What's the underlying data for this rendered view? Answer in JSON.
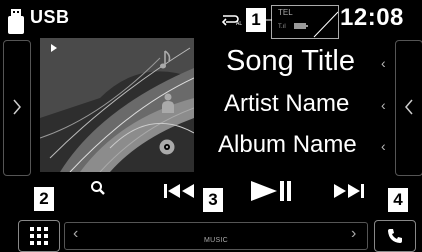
{
  "status_bar": {
    "source": "USB",
    "phone": {
      "tel_label": "TEL",
      "signal_label": "T.ıl"
    },
    "clock": "12:08"
  },
  "callouts": {
    "c1": "1",
    "c2": "2",
    "c3": "3",
    "c4": "4"
  },
  "track": {
    "song_title": "Song Title",
    "artist_name": "Artist Name",
    "album_name": "Album Name"
  },
  "info_chevrons": {
    "c1": "‹",
    "c2": "‹",
    "c3": "‹"
  },
  "source_bar": {
    "label": "MUSIC",
    "left_chevron": "‹",
    "right_chevron": "›"
  },
  "icons": {
    "status": [
      "usb-icon",
      "repeat-icon",
      "battery-icon"
    ],
    "meta": [
      "note-icon",
      "person-icon",
      "disc-icon"
    ],
    "transport": [
      "search-icon",
      "prev-icon",
      "play-pause-icon",
      "next-icon"
    ],
    "bottom": [
      "menu-grid-icon",
      "phone-icon"
    ]
  },
  "colors": {
    "background": "#000000",
    "text": "#ffffff",
    "muted": "#aaaaaa",
    "callout_bg": "#ffffff"
  }
}
